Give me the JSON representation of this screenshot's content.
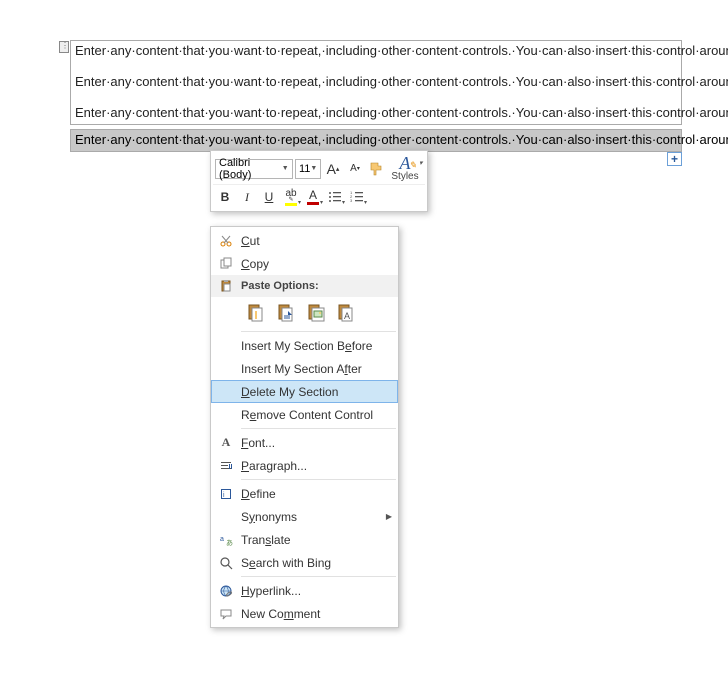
{
  "doc": {
    "paragraph": "Enter·any·content·that·you·want·to·repeat,·including·other·content·controls.·You·can·also·insert·this·control·around·table·rows·in·order·to·repeat·parts·of·a·table.¶",
    "add_symbol": "+"
  },
  "mini_toolbar": {
    "font_name": "Calibri (Body)",
    "font_size": "11",
    "styles_label": "Styles",
    "bold": "B",
    "italic": "I",
    "underline": "U",
    "grow": "A",
    "shrink": "A",
    "font_color_letter": "A",
    "styles_A": "A"
  },
  "context_menu": {
    "cut": "Cut",
    "copy": "Copy",
    "paste_header": "Paste Options:",
    "insert_before": "Insert My Section Before",
    "insert_after": "Insert My Section After",
    "delete_section": "Delete My Section",
    "remove_cc": "Remove Content Control",
    "font": "Font...",
    "paragraph": "Paragraph...",
    "define": "Define",
    "synonyms": "Synonyms",
    "translate": "Translate",
    "search_bing": "Search with Bing",
    "hyperlink": "Hyperlink...",
    "new_comment": "New Comment"
  }
}
